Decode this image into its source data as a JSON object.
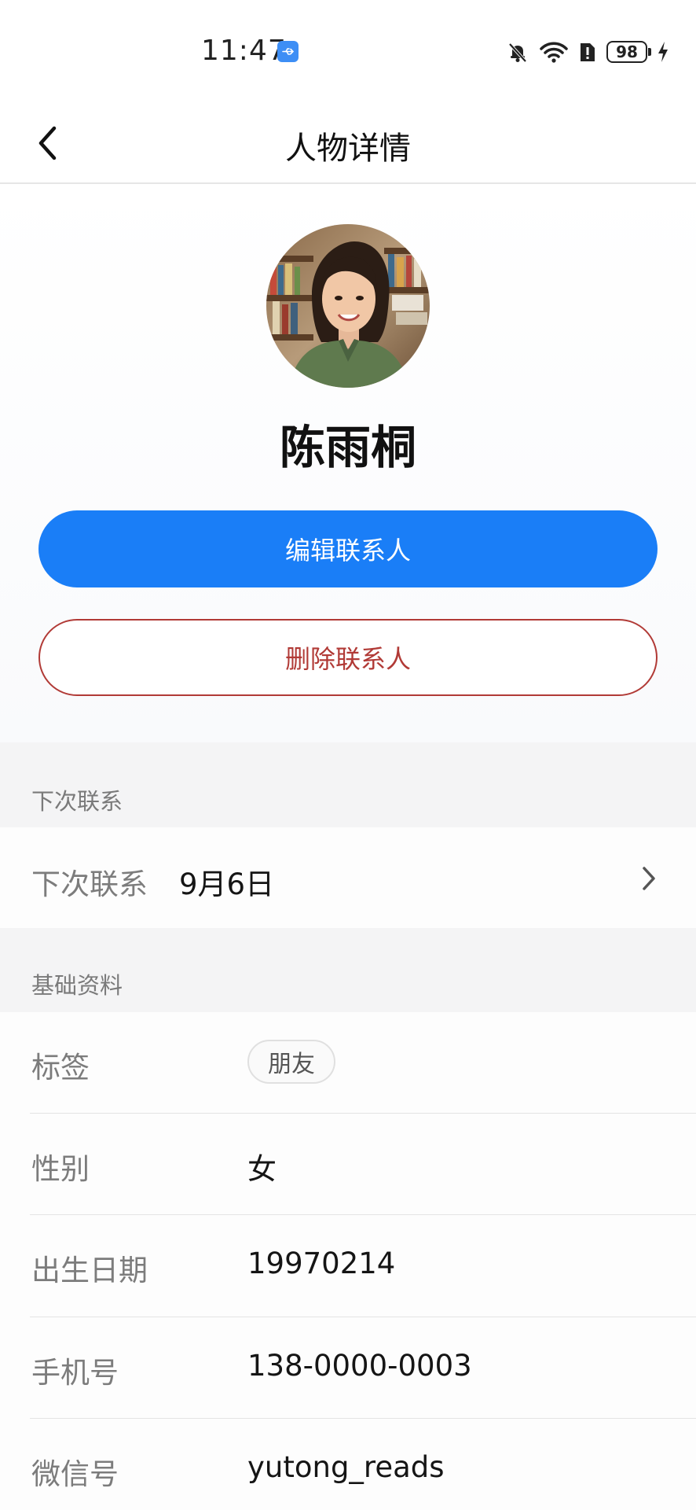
{
  "status_bar": {
    "time": "11:47",
    "battery": "98",
    "icons": [
      "usb-icon",
      "mute-bell-icon",
      "wifi-icon",
      "sim-alert-icon",
      "battery-icon",
      "charging-icon"
    ]
  },
  "nav": {
    "title": "人物详情",
    "back_icon": "chevron-left-icon"
  },
  "profile": {
    "name": "陈雨桐",
    "edit_label": "编辑联系人",
    "delete_label": "删除联系人"
  },
  "sections": {
    "next_contact": {
      "header": "下次联系",
      "label": "下次联系",
      "value": "9月6日"
    },
    "basic_info": {
      "header": "基础资料",
      "rows": [
        {
          "label": "标签",
          "value": "朋友"
        },
        {
          "label": "性别",
          "value": "女"
        },
        {
          "label": "出生日期",
          "value": "19970214"
        },
        {
          "label": "手机号",
          "value": "138-0000-0003"
        },
        {
          "label": "微信号",
          "value": "yutong_reads"
        }
      ]
    }
  },
  "colors": {
    "primary": "#1a7ef7",
    "danger": "#b13a36",
    "section_bg": "#f4f4f5"
  }
}
